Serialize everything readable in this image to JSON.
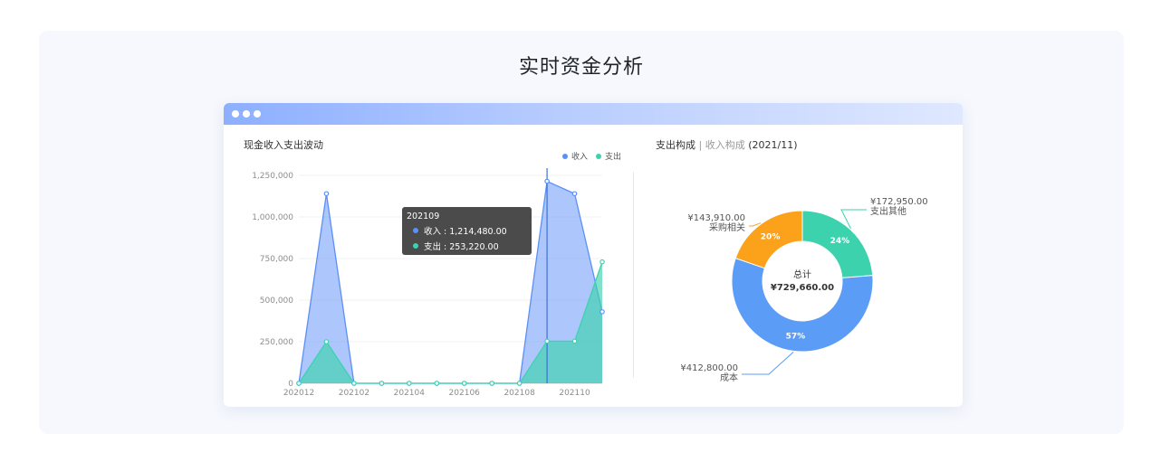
{
  "page_title": "实时资金分析",
  "window": {
    "dots": 3
  },
  "left_panel": {
    "title": "现金收入支出波动",
    "legend": [
      {
        "label": "收入",
        "color": "#5b8ff9"
      },
      {
        "label": "支出",
        "color": "#3dd2ae"
      }
    ],
    "tooltip": {
      "period": "202109",
      "rows": [
        {
          "label": "收入 : 1,214,480.00",
          "color": "#5b8ff9"
        },
        {
          "label": "支出 : 253,220.00",
          "color": "#3dd2ae"
        }
      ]
    }
  },
  "right_panel": {
    "title_active": "支出构成",
    "title_separator": " | ",
    "title_inactive": "收入构成",
    "title_period": " (2021/11)",
    "donut_center": {
      "line1": "总计",
      "line2": "¥729,660.00"
    }
  },
  "chart_data": [
    {
      "type": "area",
      "x": [
        "202012",
        "202101",
        "202102",
        "202103",
        "202104",
        "202105",
        "202106",
        "202107",
        "202108",
        "202109",
        "202110",
        "202111"
      ],
      "x_tick_labels": [
        "202012",
        "202102",
        "202104",
        "202106",
        "202108",
        "202110"
      ],
      "y_tick_labels": [
        "0",
        "250,000",
        "500,000",
        "750,000",
        "1,000,000",
        "1,250,000"
      ],
      "ylim": [
        0,
        1250000
      ],
      "grid": true,
      "legend_position": "top-right",
      "series": [
        {
          "name": "收入",
          "color": "#5b8ff9",
          "values": [
            0,
            1140000,
            0,
            0,
            0,
            0,
            0,
            0,
            0,
            1214480,
            1140000,
            430000
          ]
        },
        {
          "name": "支出",
          "color": "#3dd2ae",
          "values": [
            0,
            250000,
            0,
            0,
            0,
            0,
            0,
            0,
            0,
            253220,
            253220,
            730000
          ]
        }
      ],
      "highlight_index": 9
    },
    {
      "type": "pie",
      "slices": [
        {
          "label": "支出其他",
          "amount": "¥172,950.00",
          "value": 172950,
          "percent": "24%",
          "color": "#3dd2ae"
        },
        {
          "label": "成本",
          "amount": "¥412,800.00",
          "value": 412800,
          "percent": "57%",
          "color": "#5b9cf6"
        },
        {
          "label": "采购相关",
          "amount": "¥143,910.00",
          "value": 143910,
          "percent": "20%",
          "color": "#fca11a"
        }
      ]
    }
  ]
}
